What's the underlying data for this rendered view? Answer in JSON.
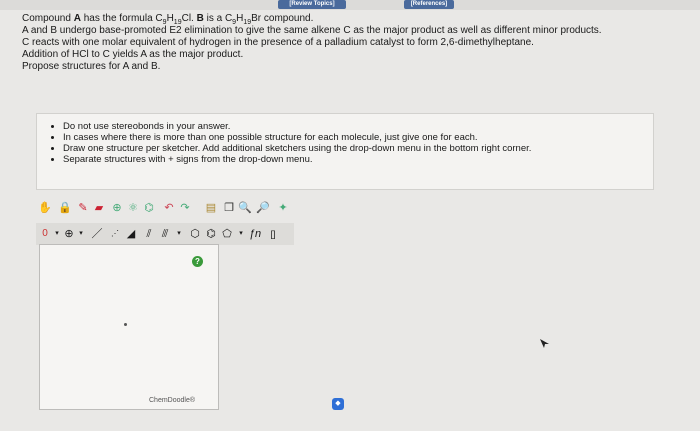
{
  "header": {
    "review_label": "[Review Topics]",
    "references_label": "[References]"
  },
  "question": {
    "line1_pre": "Compound ",
    "line1_A": "A",
    "line1_mid": " has the formula C",
    "line1_s1": "9",
    "line1_h": "H",
    "line1_s2": "19",
    "line1_cl": "Cl. ",
    "line1_B": "B",
    "line1_mid2": " is a C",
    "line1_s3": "9",
    "line1_h2": "H",
    "line1_s4": "19",
    "line1_end": "Br compound.",
    "line2": "A and B undergo base-promoted E2 elimination to give the same alkene C as the major product as well as different minor products.",
    "line3": "C reacts with one molar equivalent of hydrogen in the presence of a palladium catalyst to form 2,6-dimethylheptane.",
    "line4": "Addition of HCl to C yields A as the major product.",
    "line5": "Propose structures for A and B."
  },
  "instructions": [
    "Do not use stereobonds in your answer.",
    "In cases where there is more than one possible structure for each molecule, just give one for each.",
    "Draw one structure per sketcher. Add additional sketchers using the drop-down menu in the bottom right corner.",
    "Separate structures with + signs from the drop-down menu."
  ],
  "sketcher": {
    "help_label": "?",
    "brand": "ChemDoodle®",
    "charge_label": "0",
    "spinner_label": "◆",
    "formula_label": "ƒn"
  },
  "colors": {
    "topbar_button": "#4a6a9c",
    "help_green": "#3a9a3a",
    "spinner_blue": "#2f6fd6"
  }
}
